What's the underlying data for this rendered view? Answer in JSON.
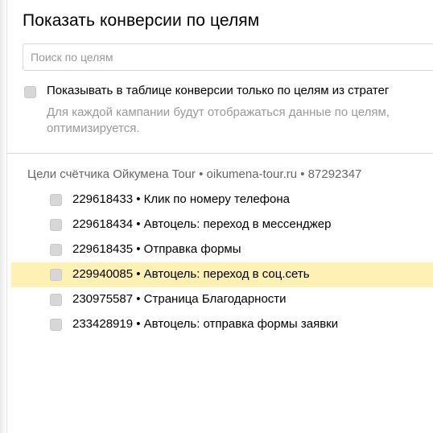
{
  "dialog": {
    "title": "Показать конверсии по целям"
  },
  "search": {
    "placeholder": "Поиск по целям",
    "value": ""
  },
  "strategy_option": {
    "label": "Показывать в таблице конверсии только по целям из стратег",
    "hint": "Для каждой кампании будут отображаться данные по целям,\nоптимизируется.",
    "checked": false
  },
  "counter": {
    "header": "Цели счётчика Ойкумена Tour • oikumena-tour.ru • 87292347"
  },
  "goals": [
    {
      "text": "229618433 • Клик по номеру телефона",
      "checked": false,
      "highlighted": false
    },
    {
      "text": "229618434 • Автоцель: переход в мессенджер",
      "checked": false,
      "highlighted": false
    },
    {
      "text": "229618435 • Отправка формы",
      "checked": false,
      "highlighted": false
    },
    {
      "text": "229940085 • Автоцель: переход в соц.сеть",
      "checked": false,
      "highlighted": true
    },
    {
      "text": "230975587 • Страница Благодарности",
      "checked": false,
      "highlighted": false
    },
    {
      "text": "233428919 • Автоцель: отправка формы заявки",
      "checked": false,
      "highlighted": false
    }
  ],
  "colors": {
    "highlight": "#fff0b3",
    "hint_text": "#999999",
    "checkbox": "#d7d7d7"
  }
}
